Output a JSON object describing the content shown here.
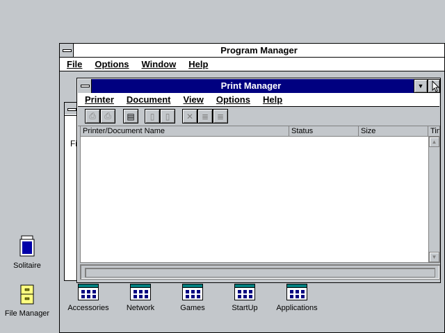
{
  "program_manager": {
    "title": "Program Manager",
    "menu": [
      "File",
      "Options",
      "Window",
      "Help"
    ],
    "background_group_text": "Fi",
    "group_icons": [
      "Accessories",
      "Network",
      "Games",
      "StartUp",
      "Applications"
    ]
  },
  "print_manager": {
    "title": "Print Manager",
    "menu": [
      "Printer",
      "Document",
      "View",
      "Options",
      "Help"
    ],
    "columns": [
      "Printer/Document Name",
      "Status",
      "Size",
      "Tin"
    ],
    "toolbar_icons": [
      "pause-printer-icon",
      "resume-printer-icon",
      "print-queue-icon",
      "pause-document-icon",
      "resume-document-icon",
      "delete-document-icon",
      "move-up-icon",
      "move-down-icon"
    ]
  },
  "desktop_icons": [
    {
      "label": "Solitaire",
      "icon": "solitaire-icon"
    },
    {
      "label": "File Manager",
      "icon": "file-manager-icon"
    }
  ],
  "colors": {
    "active_title": "#000080",
    "desktop": "#c3c7cb",
    "window_bg": "#ffffff"
  }
}
